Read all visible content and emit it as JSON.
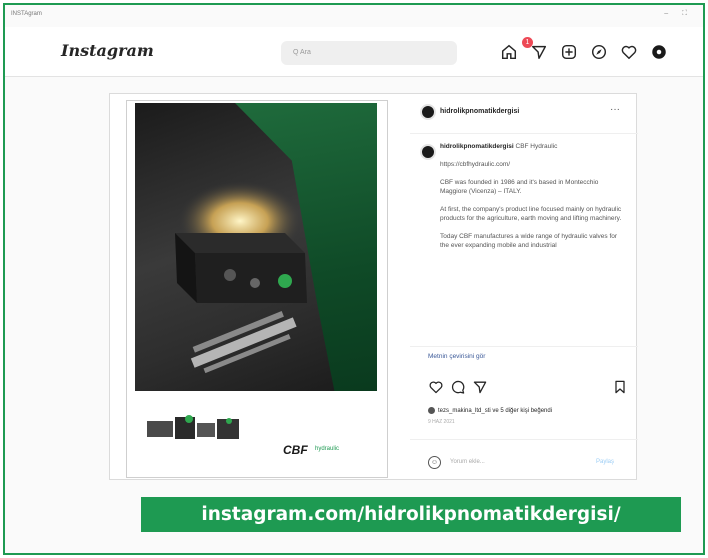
{
  "window": {
    "title": "INSTAgram",
    "controls": "– ⛶"
  },
  "instagram": {
    "logo": "Instagram",
    "logo_caret": "⌄",
    "search_placeholder": "Q Ara",
    "notification_count": "1"
  },
  "post": {
    "username": "hidrolikpnomatikdergisi",
    "more": "···",
    "ad": {
      "brand": "CBF",
      "brand_sub": "hydraulic"
    },
    "caption": {
      "author": "hidrolikpnomatikdergisi",
      "paragraphs": [
        "CBF Hydraulic",
        "https://cbfhydraulic.com/",
        "CBF was founded in 1986 and it's based in Montecchio Maggiore (Vicenza) – ITALY.",
        "At first, the company's product line focused mainly on hydraulic products for the agriculture, earth moving and lifting machinery.",
        "Today CBF manufactures a wide range of hydraulic valves for the ever expanding mobile and industrial"
      ]
    },
    "translate": "Metnin çevirisini gör",
    "likes": "tezs_makina_ltd_sti ve 5 diğer kişi beğendi",
    "date": "9 HAZ 2021",
    "comment_placeholder": "Yorum ekle...",
    "share": "Paylaş"
  },
  "banner": {
    "text": "instagram.com/hidrolikpnomatikdergisi/"
  },
  "colors": {
    "brand_green": "#1e9a52",
    "ig_badge": "#ed4956"
  }
}
